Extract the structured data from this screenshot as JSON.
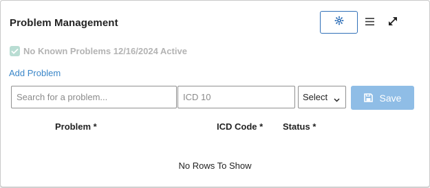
{
  "header": {
    "title": "Problem Management",
    "icons": [
      "gear-icon",
      "hamburger-menu-icon",
      "expand-icon"
    ]
  },
  "no_known_problems": {
    "checked": true,
    "label": "No Known Problems 12/16/2024 Active"
  },
  "add_problem_link": "Add Problem",
  "form": {
    "search_placeholder": "Search for a problem...",
    "icd_placeholder": "ICD 10",
    "status_select": {
      "selected": "Select"
    },
    "save_label": "Save",
    "save_icon": "floppy-disk-icon"
  },
  "table": {
    "columns": [
      "Problem *",
      "ICD Code *",
      "Status *"
    ],
    "empty_message": "No Rows To Show"
  },
  "colors": {
    "accent_blue": "#2f6fb7",
    "link_blue": "#3a86c8",
    "save_disabled": "#8fbde6",
    "checkbox_fill": "#b9ddd3",
    "disabled_text": "#b3b3b3"
  }
}
